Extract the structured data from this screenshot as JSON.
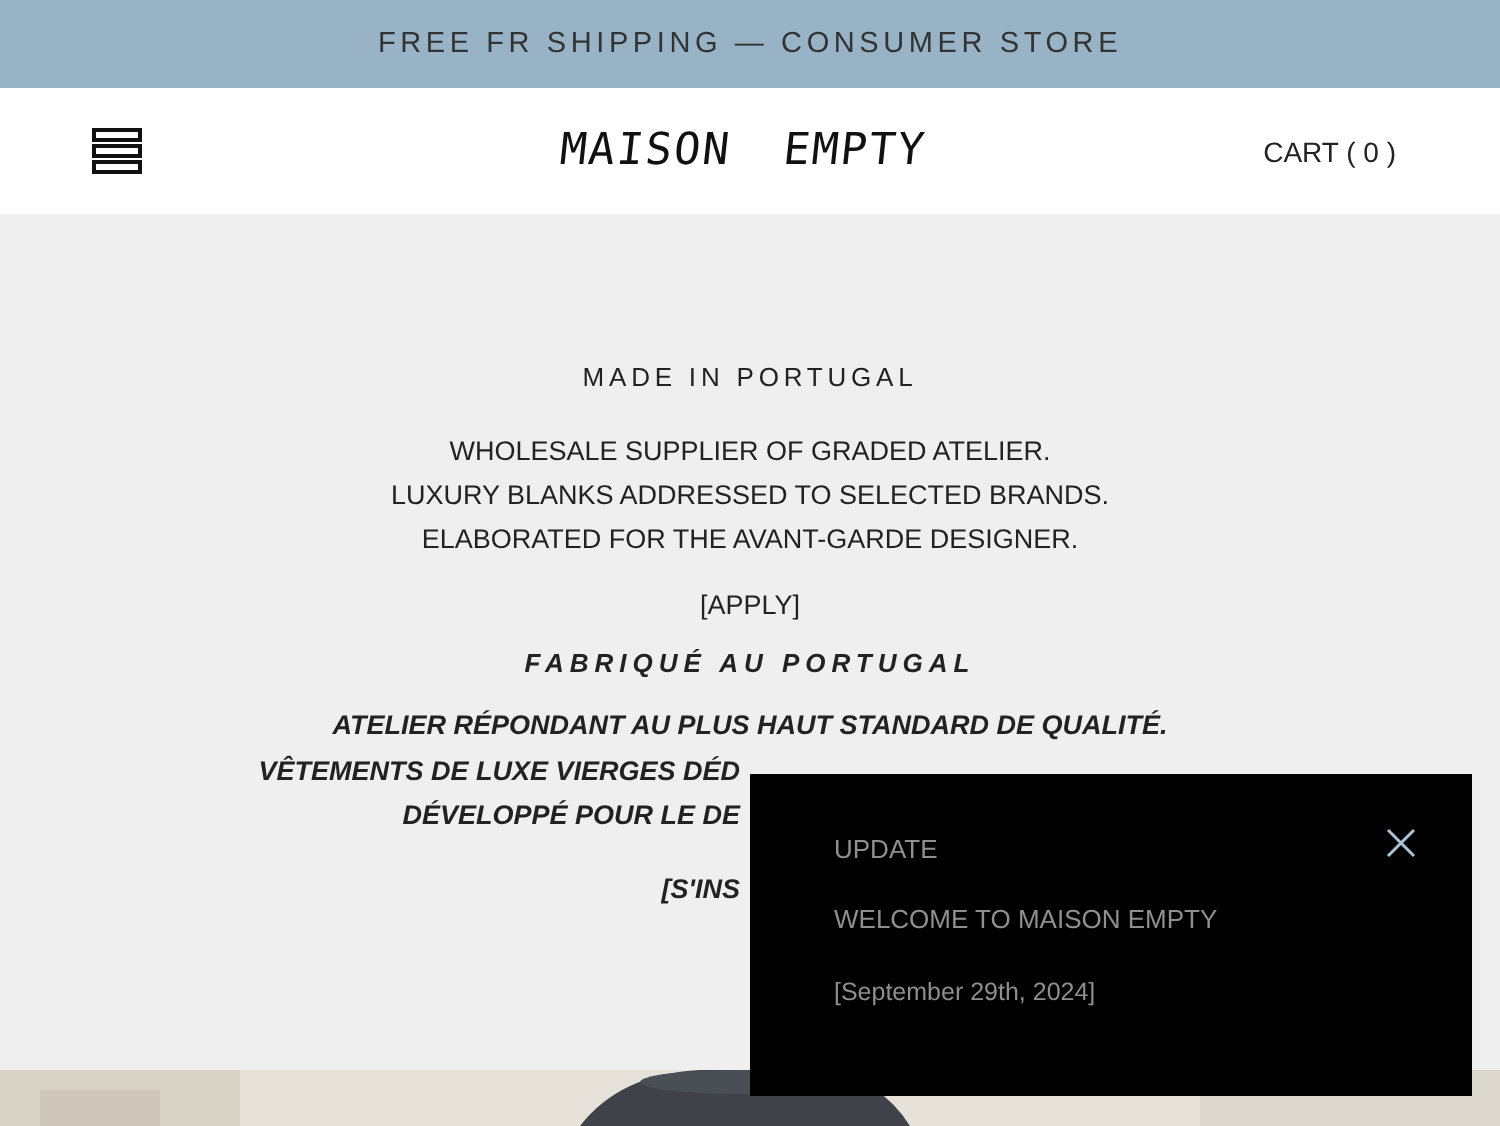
{
  "announcement_bar": {
    "text": "FREE FR SHIPPING — CONSUMER STORE"
  },
  "header": {
    "logo": "MAISON EMPTY",
    "cart": "CART ( 0 )"
  },
  "intro": {
    "heading": "MADE IN PORTUGAL",
    "lines": [
      "WHOLESALE SUPPLIER OF GRADED ATELIER.",
      "LUXURY BLANKS ADDRESSED TO SELECTED BRANDS.",
      "ELABORATED FOR THE AVANT-GARDE DESIGNER."
    ],
    "link": "[APPLY]",
    "heading_fr": "FABRIQUÉ AU PORTUGAL",
    "lines_fr": [
      "ATELIER RÉPONDANT AU PLUS HAUT STANDARD DE QUALITÉ.",
      "VÊTEMENTS DE LUXE VIERGES DÉD",
      "DÉVELOPPÉ POUR LE DE"
    ],
    "link_fr": "[S'INS"
  },
  "popup": {
    "title": "UPDATE",
    "message": "WELCOME TO MAISON EMPTY",
    "date": "[September 29th, 2024]"
  }
}
